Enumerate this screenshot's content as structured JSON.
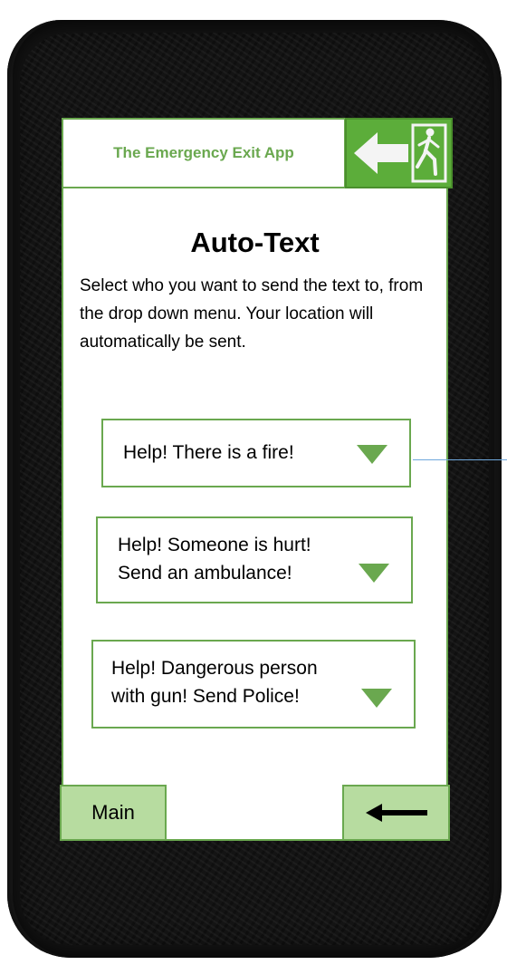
{
  "header": {
    "app_name": "The Emergency Exit App",
    "exit_icon": "emergency-exit-sign-icon"
  },
  "page": {
    "title": "Auto-Text",
    "instructions": "Select who you want to send the text to, from the drop down menu. Your location will automatically be sent."
  },
  "messages": [
    {
      "lines": [
        "Help! There is a fire!"
      ],
      "icon": "dropdown-triangle-icon"
    },
    {
      "lines": [
        "Help! Someone is hurt!",
        "Send an ambulance!"
      ],
      "icon": "dropdown-triangle-icon"
    },
    {
      "lines": [
        "Help! Dangerous person",
        "with gun! Send Police!"
      ],
      "icon": "dropdown-triangle-icon"
    }
  ],
  "footer": {
    "main_label": "Main",
    "back_icon": "back-arrow-icon"
  },
  "colors": {
    "accent": "#6aa84f",
    "button_fill": "#b7dca0",
    "exit_sign": "#5cad3a",
    "connector": "#6fa8dc",
    "phone_body": "#141414"
  }
}
